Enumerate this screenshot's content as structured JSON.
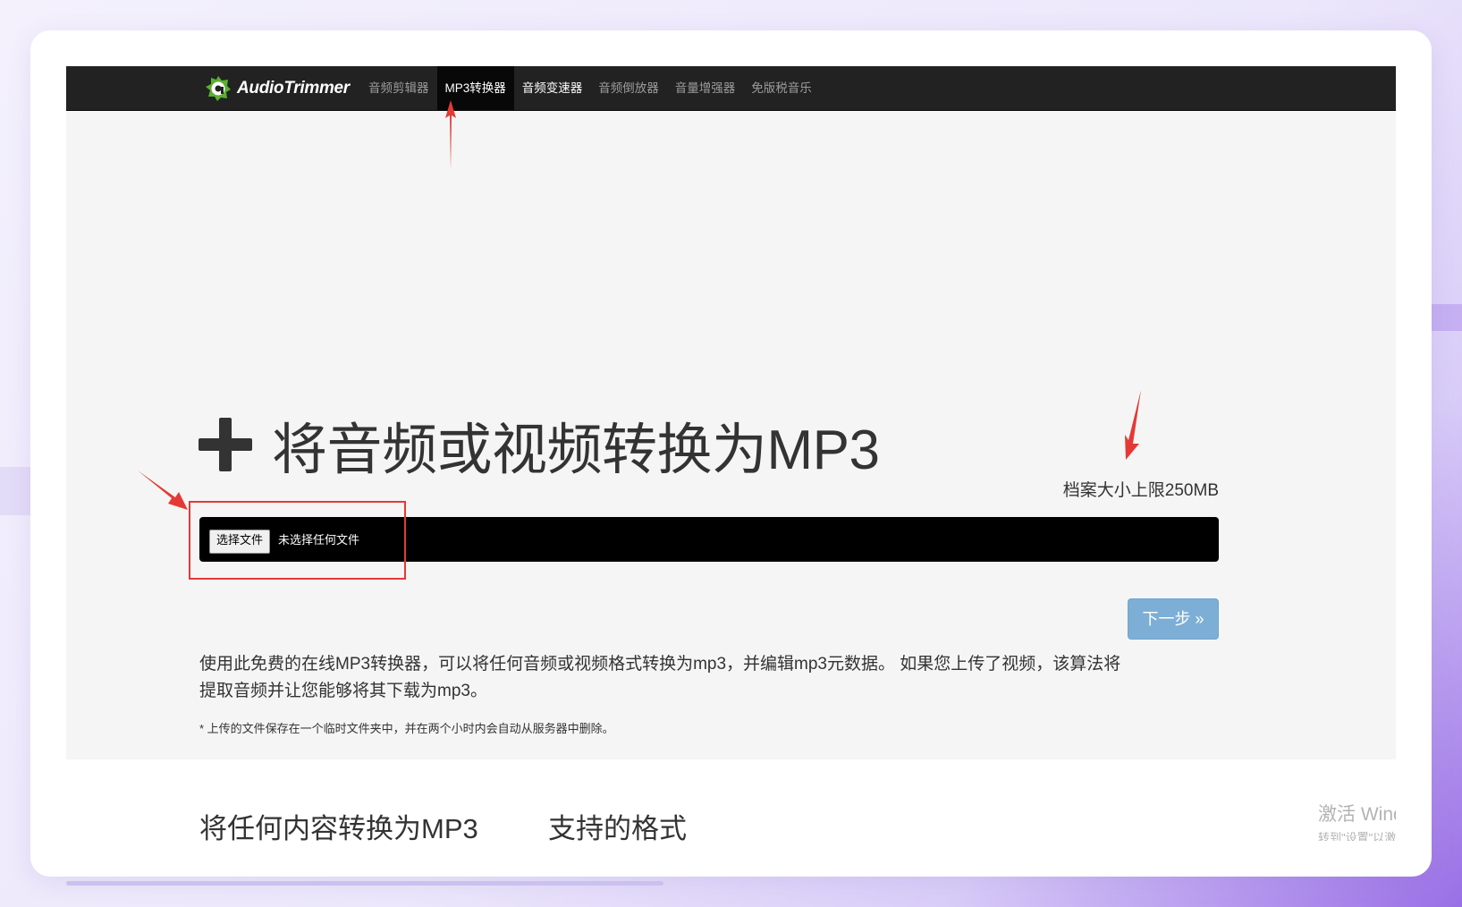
{
  "brand": {
    "name": "AudioTrimmer",
    "logo_icon": "audiotrimmer-logo-icon",
    "accent": "#5ab030"
  },
  "nav": {
    "items": [
      {
        "label": "音频剪辑器",
        "active": false
      },
      {
        "label": "MP3转换器",
        "active": true
      },
      {
        "label": "音频变速器",
        "active": false
      },
      {
        "label": "音频倒放器",
        "active": false
      },
      {
        "label": "音量增强器",
        "active": false
      },
      {
        "label": "免版税音乐",
        "active": false
      }
    ]
  },
  "hero": {
    "icon": "plus-icon",
    "title": "将音频或视频转换为MP3",
    "file_limit": "档案大小上限250MB"
  },
  "upload": {
    "choose_label": "选择文件",
    "status_text": "未选择任何文件"
  },
  "actions": {
    "next_label": "下一步 »"
  },
  "description": {
    "line1": "使用此免费的在线MP3转换器，可以将任何音频或视频格式转换为mp3，并编辑mp3元数据。 如果您上传了视频，该算法将",
    "line2": "提取音频并让您能够将其下载为mp3。",
    "footnote": "* 上传的文件保存在一个临时文件夹中，并在两个小时内会自动从服务器中删除。"
  },
  "sections": {
    "convert_heading": "将任何内容转换为MP3",
    "formats_heading": "支持的格式"
  },
  "os_overlay": {
    "line1": "激活 Windows",
    "line2": "转到\"设置\"以激活Windows。"
  },
  "annotations": {
    "color": "#e53935",
    "arrow_icon": "red-arrow-icon"
  }
}
